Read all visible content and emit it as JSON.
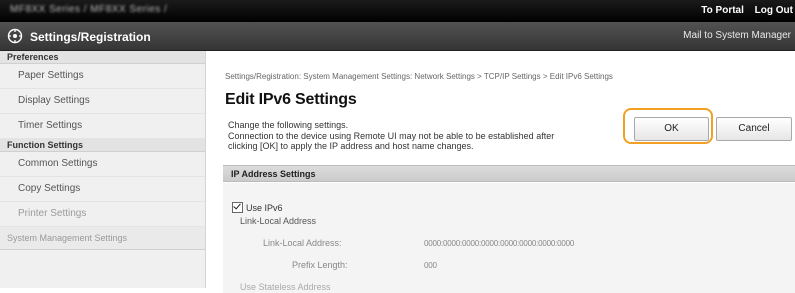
{
  "topbar": {
    "model": "MF8XX Series / MF8XX Series /",
    "portal_link": "To Portal",
    "logout_link": "Log Out"
  },
  "header": {
    "title": "Settings/Registration",
    "mail_link": "Mail to System Manager",
    "logo_icon": "settings-gear-icon"
  },
  "sidebar": {
    "groups": [
      {
        "label": "Preferences",
        "items": [
          "Paper Settings",
          "Display Settings",
          "Timer Settings"
        ]
      },
      {
        "label": "Function Settings",
        "items": [
          "Common Settings",
          "Copy Settings",
          "Printer Settings"
        ]
      },
      {
        "label": "System Management Settings",
        "items": []
      }
    ]
  },
  "main": {
    "breadcrumb": "Settings/Registration: System Management Settings: Network Settings > TCP/IP Settings > Edit IPv6 Settings",
    "title": "Edit IPv6 Settings",
    "desc_line1": "Change the following settings.",
    "desc_line2": "Connection to the device using Remote UI may not be able to be established after",
    "desc_line3": "clicking [OK] to apply the IP address and host name changes.",
    "ok_label": "OK",
    "cancel_label": "Cancel",
    "section_title": "IP Address Settings",
    "use_ipv6_label": "Use IPv6",
    "use_ipv6_checked": true,
    "link_local_heading": "Link-Local Address",
    "link_local_address_label": "Link-Local Address:",
    "link_local_address_value": "0000:0000:0000:0000:0000:0000:0000:0000",
    "prefix_length_label": "Prefix Length:",
    "prefix_length_value": "000",
    "cut_label": "Use Stateless Address"
  },
  "colors": {
    "highlight": "#f2a024",
    "header_bg": "#3f3f3f",
    "topbar_bg": "#000000"
  }
}
